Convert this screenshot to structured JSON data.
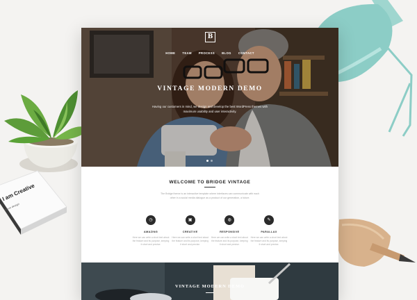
{
  "hero": {
    "logo": "B",
    "nav": [
      "HOME",
      "TEAM",
      "PROCESS",
      "BLOG",
      "CONTACT"
    ],
    "title": "VINTAGE MODERN DEMO",
    "text": "Having our customers in mind, we design and develop the best WordPress themes with maximum usability and user interactivity."
  },
  "welcome": {
    "title": "WELCOME TO BRIDGE VINTAGE",
    "text": "The Bridge theme is an interactive template where interfaces can communicate with each other in a social media dialogue as a product of our generation, a future."
  },
  "features": [
    {
      "icon": "clock-icon",
      "glyph": "◷",
      "title": "AMAZING",
      "text": "Here we can write a short text about the feature and its purpose, keeping it short and precise."
    },
    {
      "icon": "camera-icon",
      "glyph": "▣",
      "title": "CREATIVE",
      "text": "Here we can write a short text about the feature and its purpose, keeping it short and precise."
    },
    {
      "icon": "chat-icon",
      "glyph": "◍",
      "title": "RESPONSIVE",
      "text": "Here we can write a short text about the feature and its purpose, keeping it short and precise."
    },
    {
      "icon": "pin-icon",
      "glyph": "✎",
      "title": "PARALLAX",
      "text": "Here we can write a short text about the feature and its purpose, keeping it short and precise."
    }
  ],
  "bottom": {
    "title": "VINTAGE MODERN DEMO"
  },
  "book": {
    "title": "I am Creative",
    "subtitle": "I love design"
  },
  "colors": {
    "dark": "#2b2b2b",
    "accent_lamp": "#8ccdc6",
    "background": "#f4f3f1"
  }
}
